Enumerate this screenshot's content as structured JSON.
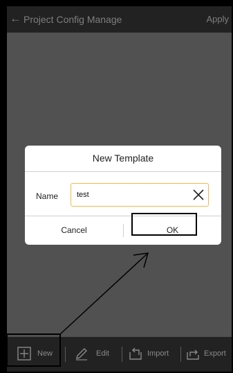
{
  "header": {
    "back_icon": "arrow-left-icon",
    "title": "Project Config Manage",
    "apply_label": "Apply"
  },
  "dialog": {
    "title": "New Template",
    "name_label": "Name",
    "name_value": "test",
    "clear_icon": "close-icon",
    "cancel_label": "Cancel",
    "ok_label": "OK"
  },
  "toolbar": {
    "items": [
      {
        "label": "New",
        "icon": "plus-square-icon"
      },
      {
        "label": "Edit",
        "icon": "pencil-icon"
      },
      {
        "label": "Import",
        "icon": "import-icon"
      },
      {
        "label": "Export",
        "icon": "export-icon"
      }
    ]
  },
  "colors": {
    "header_bg": "#222222",
    "screen_bg": "#515151",
    "dialog_bg": "#ffffff",
    "input_border": "#f0b84a",
    "annotation": "#000000"
  }
}
